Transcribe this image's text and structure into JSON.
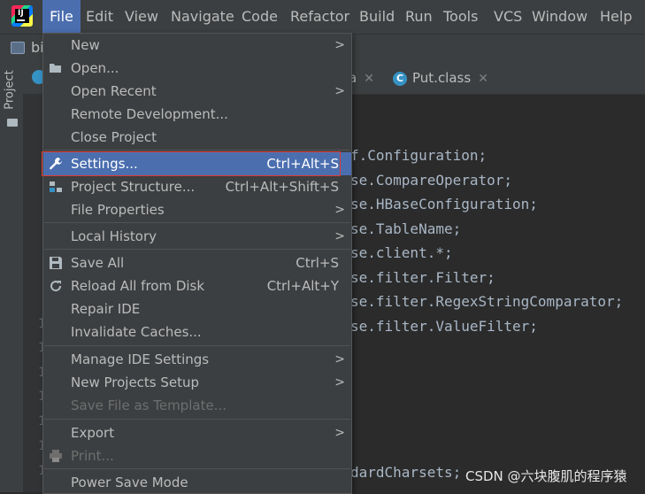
{
  "menubar": {
    "items": [
      "File",
      "Edit",
      "View",
      "Navigate",
      "Code",
      "Refactor",
      "Build",
      "Run",
      "Tools",
      "VCS",
      "Window",
      "Help"
    ]
  },
  "breadcrumb": "bi",
  "sidebar": {
    "project_label": "Project"
  },
  "tabs": [
    {
      "label": "a"
    },
    {
      "label": "Put.class"
    }
  ],
  "code_lines": [
    "f.Configuration;",
    "se.CompareOperator;",
    "se.HBaseConfiguration;",
    "se.TableName;",
    "se.client.*;",
    "se.filter.Filter;",
    "se.filter.RegexStringComparator;",
    "se.filter.ValueFilter;",
    "dardCharsets;"
  ],
  "line_numbers": [
    "1",
    "1",
    "1",
    "1",
    "1",
    "1",
    "1"
  ],
  "file_menu": [
    {
      "label": "New",
      "shortcut": "",
      "submenu": true
    },
    {
      "label": "Open...",
      "shortcut": "",
      "submenu": false
    },
    {
      "label": "Open Recent",
      "shortcut": "",
      "submenu": true
    },
    {
      "label": "Remote Development...",
      "shortcut": "",
      "submenu": false
    },
    {
      "label": "Close Project",
      "shortcut": "",
      "submenu": false
    },
    {
      "label": "Settings...",
      "shortcut": "Ctrl+Alt+S",
      "submenu": false
    },
    {
      "label": "Project Structure...",
      "shortcut": "Ctrl+Alt+Shift+S",
      "submenu": false
    },
    {
      "label": "File Properties",
      "shortcut": "",
      "submenu": true
    },
    {
      "label": "Local History",
      "shortcut": "",
      "submenu": true
    },
    {
      "label": "Save All",
      "shortcut": "Ctrl+S",
      "submenu": false
    },
    {
      "label": "Reload All from Disk",
      "shortcut": "Ctrl+Alt+Y",
      "submenu": false
    },
    {
      "label": "Repair IDE",
      "shortcut": "",
      "submenu": false
    },
    {
      "label": "Invalidate Caches...",
      "shortcut": "",
      "submenu": false
    },
    {
      "label": "Manage IDE Settings",
      "shortcut": "",
      "submenu": true
    },
    {
      "label": "New Projects Setup",
      "shortcut": "",
      "submenu": true
    },
    {
      "label": "Save File as Template...",
      "shortcut": "",
      "submenu": false
    },
    {
      "label": "Export",
      "shortcut": "",
      "submenu": true
    },
    {
      "label": "Print...",
      "shortcut": "",
      "submenu": false
    },
    {
      "label": "Power Save Mode",
      "shortcut": "",
      "submenu": false
    }
  ],
  "watermark": "CSDN @六块腹肌的程序猿",
  "colors": {
    "accent": "#4b6eaf",
    "highlight_border": "#e0392f",
    "background": "#2b2b2b",
    "panel": "#3c3f41"
  }
}
